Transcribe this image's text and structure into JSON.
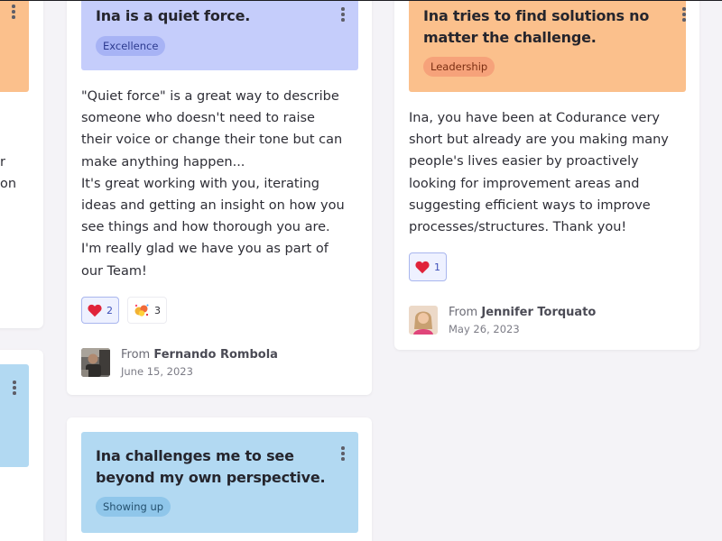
{
  "colors": {
    "background": "#f4f3f7",
    "card": "#ffffff",
    "excellence_banner": "#c5cdfb",
    "excellence_tag": "#a7b3f5",
    "leadership_banner": "#fbc08c",
    "leadership_tag": "#f6a27a",
    "showing_up_banner": "#b2d9f2",
    "showing_up_tag": "#8fc6ea",
    "reaction_active_border": "#a9b6ee"
  },
  "cards": {
    "fernando": {
      "title": "Ina is a quiet force.",
      "tag": "Excellence",
      "body": "\"Quiet force\" is a great way to describe\nsomeone who doesn't need to raise\ntheir voice or change their tone but can\nmake anything happen...\nIt's great working with you, iterating\nideas and getting an insight on how you\nsee things and how thorough you are.\nI'm really glad we have you as part of\nour Team!",
      "reactions": [
        {
          "icon": "heart-icon",
          "count": "2",
          "active": true
        },
        {
          "icon": "party-emoji-icon",
          "count": "3",
          "active": false
        }
      ],
      "from_label": "From",
      "author": "Fernando Rombola",
      "date": "June 15, 2023"
    },
    "jennifer": {
      "title": "Ina tries to find solutions no matter the challenge.",
      "tag": "Leadership",
      "body": "Ina, you have been at Codurance very\nshort but already are you making many\npeople's lives easier by proactively\nlooking for improvement areas and\nsuggesting efficient ways to improve\nprocesses/structures. Thank you!",
      "reactions": [
        {
          "icon": "heart-icon",
          "count": "1",
          "active": true
        }
      ],
      "from_label": "From",
      "author": "Jennifer Torquato",
      "date": "May 26, 2023"
    },
    "perspective": {
      "title": "Ina challenges me to see beyond my own perspective.",
      "tag": "Showing up"
    },
    "left_partial": {
      "body_fragments": [
        "r",
        "on"
      ]
    }
  }
}
